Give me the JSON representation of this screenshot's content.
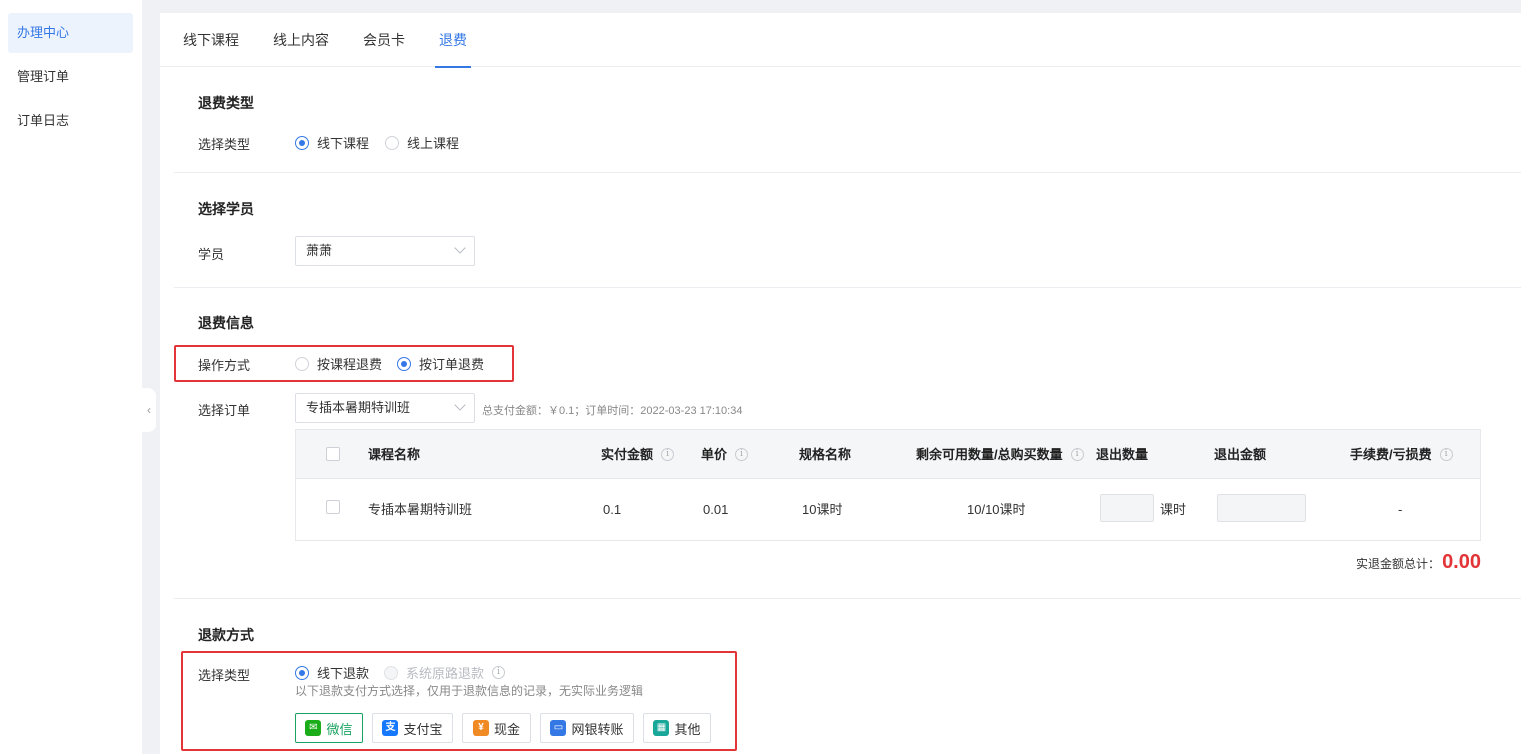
{
  "sidebar": {
    "items": [
      {
        "label": "办理中心"
      },
      {
        "label": "管理订单"
      },
      {
        "label": "订单日志"
      }
    ]
  },
  "tabs": [
    {
      "label": "线下课程"
    },
    {
      "label": "线上内容"
    },
    {
      "label": "会员卡"
    },
    {
      "label": "退费"
    }
  ],
  "refund_type": {
    "title": "退费类型",
    "field_label": "选择类型",
    "options": [
      "线下课程",
      "线上课程"
    ],
    "selected": "线下课程"
  },
  "student": {
    "title": "选择学员",
    "field_label": "学员",
    "value": "萧萧"
  },
  "refund_info": {
    "title": "退费信息",
    "operation_label": "操作方式",
    "operation_options": [
      "按课程退费",
      "按订单退费"
    ],
    "operation_selected": "按订单退费",
    "order_label": "选择订单",
    "order_value": "专插本暑期特训班",
    "order_hint": "总支付金额：￥0.1；订单时间：2022-03-23 17:10:34"
  },
  "table": {
    "headers": [
      "课程名称",
      "实付金额",
      "单价",
      "规格名称",
      "剩余可用数量/总购买数量",
      "退出数量",
      "退出金额",
      "手续费/亏损费"
    ],
    "rows": [
      {
        "course_name": "专插本暑期特训班",
        "paid_amount": "0.1",
        "unit_price": "0.01",
        "spec_name": "10课时",
        "remaining": "10/10课时",
        "unit": "课时",
        "fee": "-"
      }
    ]
  },
  "total": {
    "label": "实退金额总计：",
    "value": "0.00"
  },
  "refund_method": {
    "title": "退款方式",
    "field_label": "选择类型",
    "options": [
      "线下退款",
      "系统原路退款"
    ],
    "selected": "线下退款",
    "note": "以下退款支付方式选择，仅用于退款信息的记录，无实际业务逻辑",
    "pay_methods": [
      {
        "label": "微信",
        "icon": "wechat-icon",
        "color": "#1aad19"
      },
      {
        "label": "支付宝",
        "icon": "alipay-icon",
        "color": "#1677ff"
      },
      {
        "label": "现金",
        "icon": "cash-icon",
        "color": "#f08a24"
      },
      {
        "label": "网银转账",
        "icon": "bank-transfer-icon",
        "color": "#3478e5"
      },
      {
        "label": "其他",
        "icon": "other-icon",
        "color": "#19a79a"
      }
    ],
    "pay_selected": "微信"
  },
  "colors": {
    "accent": "#3478e5",
    "highlight_box": "#e33437",
    "total_red": "#e33437",
    "wechat_green": "#1aa260"
  }
}
